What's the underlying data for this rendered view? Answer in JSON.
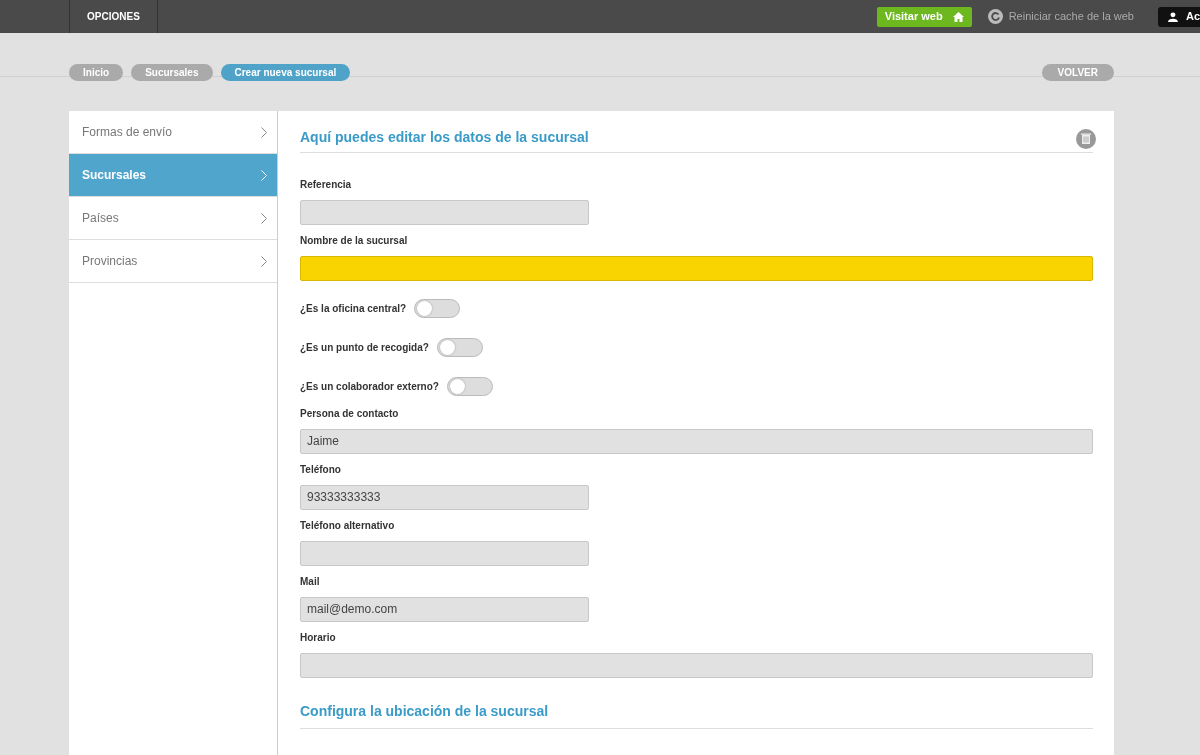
{
  "topbar": {
    "menu": "OPCIONES",
    "visit_button": "Visitar web",
    "cache_link": "Reiniciar cache de la web",
    "user_button": "Ac"
  },
  "breadcrumbs": [
    {
      "label": "Inicio",
      "selected": false
    },
    {
      "label": "Sucursales",
      "selected": false
    },
    {
      "label": "Crear nueva sucursal",
      "selected": true
    }
  ],
  "back_button": "VOLVER",
  "sidebar": {
    "items": [
      {
        "label": "Formas de envío",
        "selected": false
      },
      {
        "label": "Sucursales",
        "selected": true
      },
      {
        "label": "Países",
        "selected": false
      },
      {
        "label": "Provincias",
        "selected": false
      }
    ]
  },
  "form": {
    "title": "Aquí puedes editar los datos de la sucursal",
    "fields": [
      {
        "kind": "text",
        "label": "Referencia",
        "wide": false,
        "focused": false
      },
      {
        "kind": "text",
        "label": "Nombre de la sucursal",
        "wide": true,
        "focused": true
      },
      {
        "kind": "toggle",
        "label": "¿Es la oficina central?",
        "on": false
      },
      {
        "kind": "toggle",
        "label": "¿Es un punto de recogida?",
        "on": false
      },
      {
        "kind": "toggle",
        "label": "¿Es un colaborador externo?",
        "on": false
      },
      {
        "kind": "text",
        "label": "Persona de contacto",
        "value": "Jaime",
        "wide": true,
        "focused": false
      },
      {
        "kind": "text",
        "label": "Teléfono",
        "value": "93333333333",
        "wide": false,
        "focused": false
      },
      {
        "kind": "text",
        "label": "Teléfono alternativo",
        "wide": false,
        "focused": false
      },
      {
        "kind": "text",
        "label": "Mail",
        "value": "mail@demo.com",
        "wide": false,
        "focused": false
      },
      {
        "kind": "text",
        "label": "Horario",
        "wide": true,
        "focused": false
      }
    ],
    "section_title": "Configura la ubicación de la sucursal"
  }
}
